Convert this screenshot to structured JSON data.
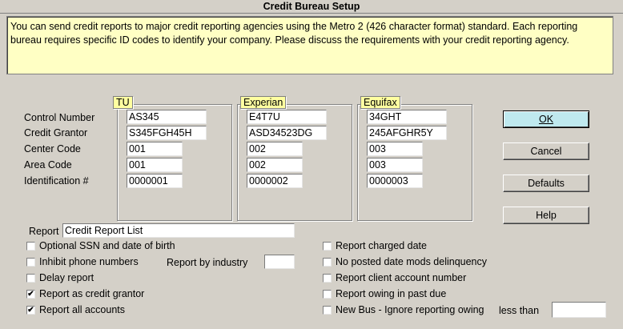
{
  "window": {
    "title": "Credit Bureau Setup"
  },
  "info_text": "You can send credit reports to major credit reporting agencies using the Metro 2 (426 character format) standard. Each reporting bureau requires specific ID codes to identify your company. Please discuss the requirements with your credit reporting agency.",
  "field_labels": [
    "Control Number",
    "Credit Grantor",
    "Center Code",
    "Area Code",
    "Identification #"
  ],
  "bureaus": [
    {
      "tag": "TU",
      "values": [
        "AS345",
        "S345FGH45H",
        "001",
        "001",
        "0000001"
      ]
    },
    {
      "tag": "Experian",
      "values": [
        "E4T7U",
        "ASD34523DG",
        "002",
        "002",
        "0000002"
      ]
    },
    {
      "tag": "Equifax",
      "values": [
        "34GHT",
        "245AFGHR5Y",
        "003",
        "003",
        "0000003"
      ]
    }
  ],
  "buttons": {
    "ok": "OK",
    "cancel": "Cancel",
    "defaults": "Defaults",
    "help": "Help"
  },
  "report": {
    "label": "Report",
    "value": "Credit Report List"
  },
  "report_by_industry": {
    "label": "Report by industry",
    "value": ""
  },
  "less_than": {
    "label": "less than",
    "value": ""
  },
  "left_options": [
    {
      "label": "Optional SSN and date of birth",
      "checked": false
    },
    {
      "label": "Inhibit phone numbers",
      "checked": false
    },
    {
      "label": "Delay report",
      "checked": false
    },
    {
      "label": "Report as credit grantor",
      "checked": true
    },
    {
      "label": "Report all accounts",
      "checked": true
    }
  ],
  "right_options": [
    {
      "label": "Report charged date",
      "checked": false
    },
    {
      "label": "No posted date mods delinquency",
      "checked": false
    },
    {
      "label": "Report client account number",
      "checked": false
    },
    {
      "label": "Report owing in past due",
      "checked": false
    },
    {
      "label": "New Bus - Ignore reporting owing",
      "checked": false
    }
  ]
}
